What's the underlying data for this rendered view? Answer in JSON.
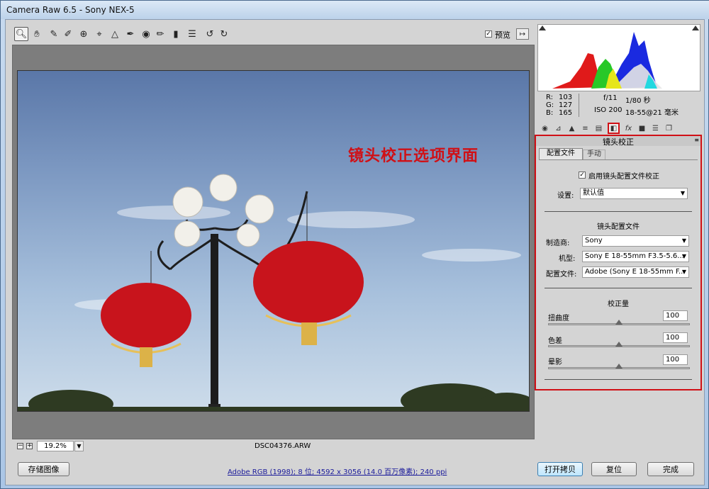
{
  "window": {
    "title": "Camera Raw 6.5 - Sony NEX-5"
  },
  "toolbar": {
    "tools": [
      "zoom-icon",
      "hand-icon",
      "white-balance-icon",
      "color-sampler-icon",
      "target-adjust-icon",
      "crop-icon",
      "straighten-icon",
      "spot-removal-icon",
      "red-eye-icon",
      "adjustment-brush-icon",
      "graduated-filter-icon",
      "preferences-icon",
      "rotate-ccw-icon",
      "rotate-cw-icon"
    ],
    "preview_label": "预览",
    "preview_checked": true
  },
  "image": {
    "caption": "镜头校正选项界面"
  },
  "status": {
    "zoom": "19.2%",
    "filename": "DSC04376.ARW"
  },
  "readout": {
    "r_label": "R:",
    "r": "103",
    "g_label": "G:",
    "g": "127",
    "b_label": "B:",
    "b": "165",
    "aperture": "f/11",
    "shutter": "1/80 秒",
    "iso": "ISO 200",
    "lens": "18-55@21 毫米"
  },
  "panel": {
    "title": "镜头校正",
    "tabs": [
      "配置文件",
      "手动"
    ],
    "enable_label": "启用镜头配置文件校正",
    "setup_label": "设置:",
    "setup_value": "默认值",
    "profile_section": "镜头配置文件",
    "make_label": "制造商:",
    "make_value": "Sony",
    "model_label": "机型:",
    "model_value": "Sony E 18-55mm F3.5-5.6...",
    "profile_label": "配置文件:",
    "profile_value": "Adobe (Sony E 18-55mm F...",
    "amount_section": "校正量",
    "sliders": [
      {
        "label": "扭曲度",
        "value": "100",
        "fraction": 0.5
      },
      {
        "label": "色差",
        "value": "100",
        "fraction": 0.5
      },
      {
        "label": "晕影",
        "value": "100",
        "fraction": 0.5
      }
    ]
  },
  "footer": {
    "save_label": "存储图像",
    "workflow_link": "Adobe RGB (1998); 8 位; 4592 x 3056 (14.0 百万像素); 240 ppi",
    "open_copy": "打开拷贝",
    "reset": "复位",
    "done": "完成"
  },
  "colors": {
    "highlight_border": "#d01016",
    "lantern_red": "#c8141c"
  }
}
